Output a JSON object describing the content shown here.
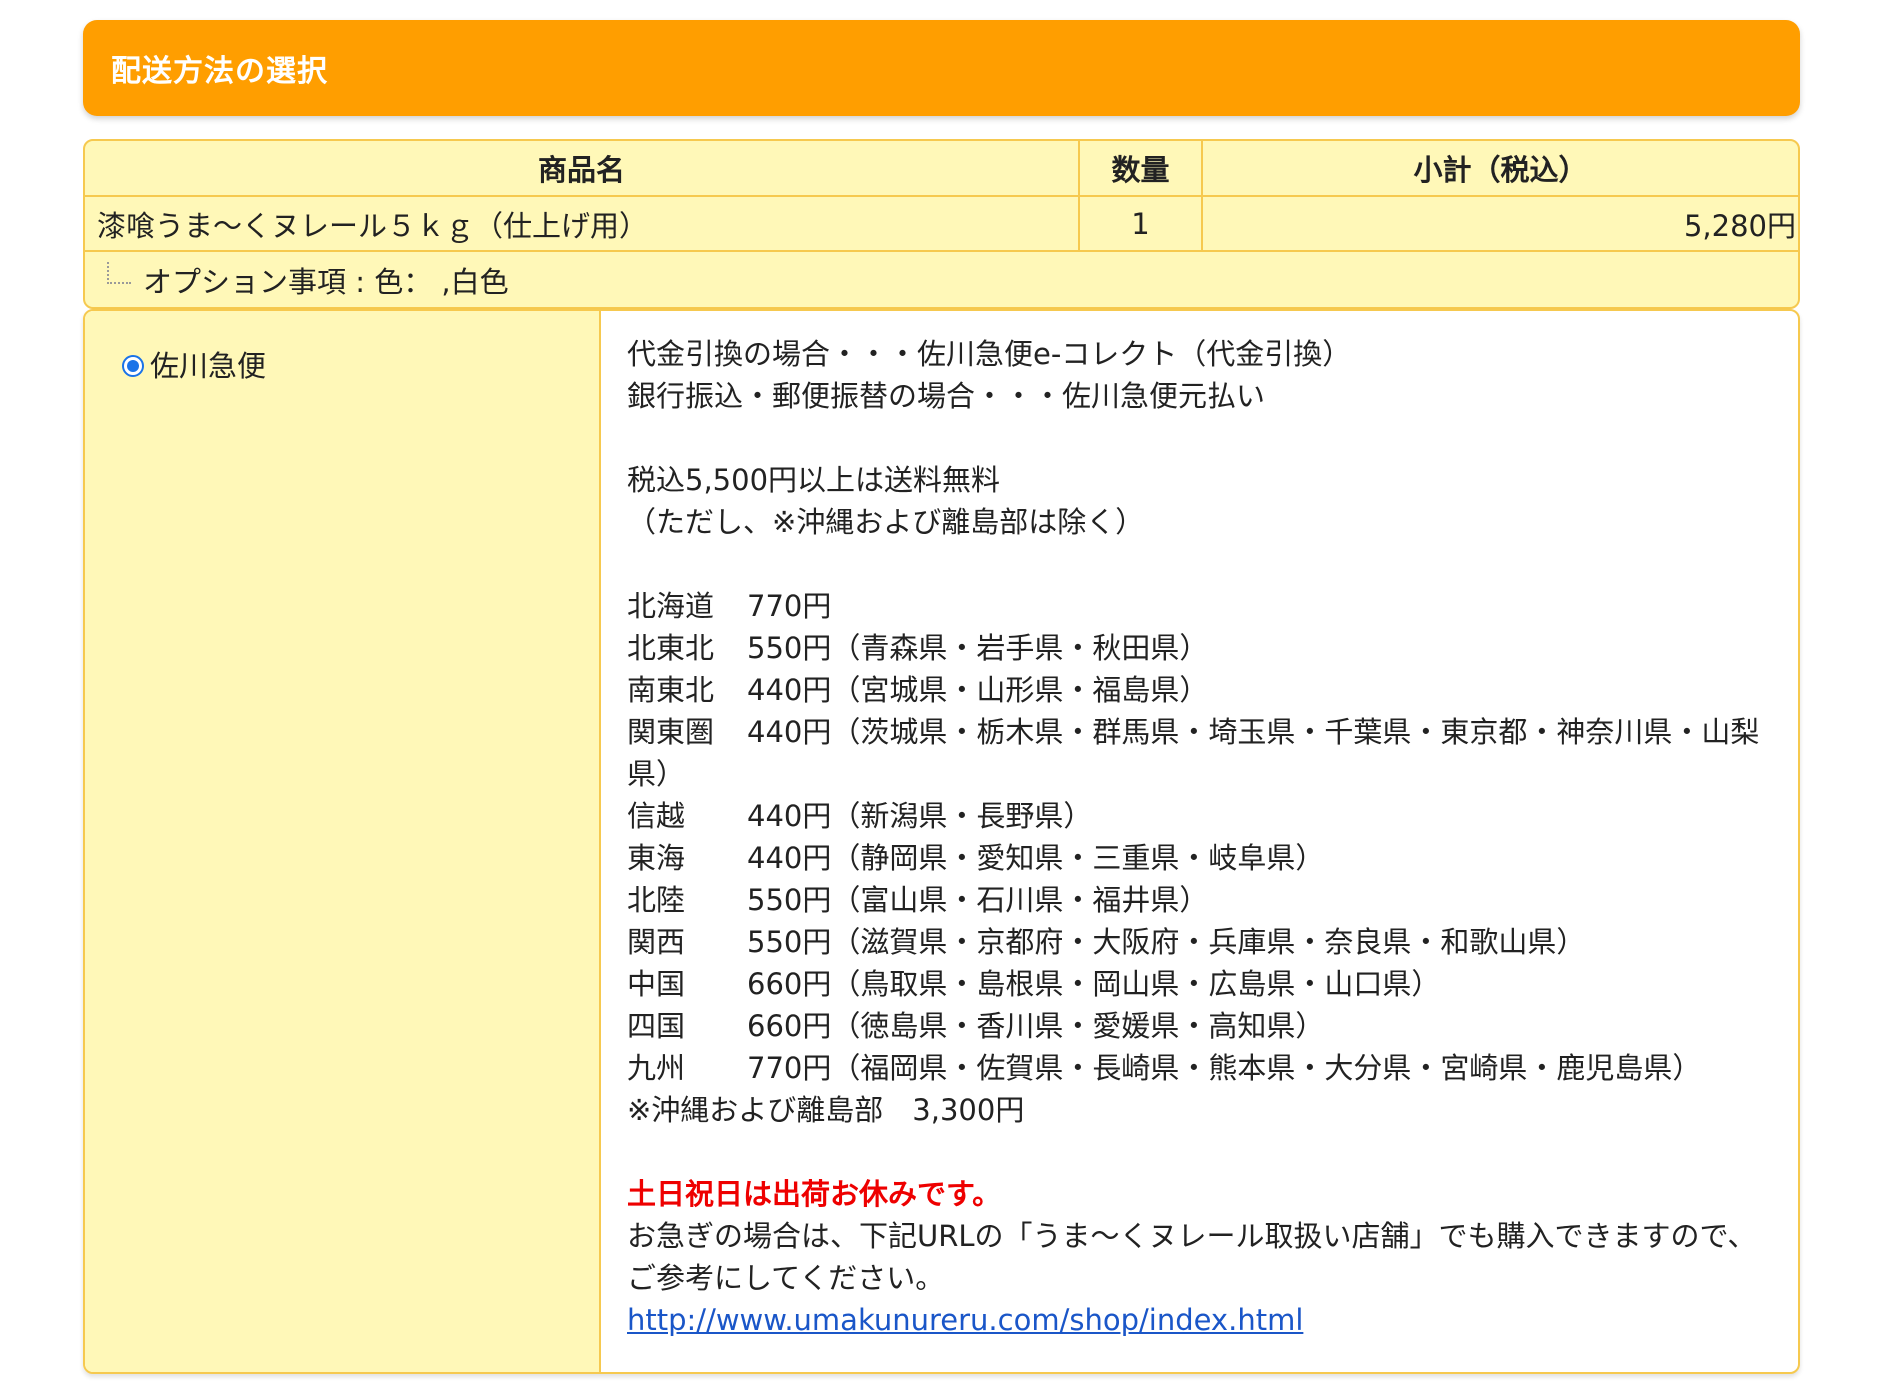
{
  "section": {
    "title": "配送方法の選択"
  },
  "table": {
    "headers": {
      "name": "商品名",
      "qty": "数量",
      "subtotal": "小計（税込）"
    },
    "item": {
      "name": "漆喰うま〜くヌレール５ｋｇ（仕上げ用）",
      "qty": "1",
      "subtotal": "5,280円"
    },
    "option": "オプション事項 : 色： ,白色"
  },
  "shipping": {
    "method_label": "佐川急便",
    "selected": true,
    "lines_a": [
      "代金引換の場合・・・佐川急便e-コレクト（代金引換）",
      "銀行振込・郵便振替の場合・・・佐川急便元払い"
    ],
    "lines_b": [
      "税込5,500円以上は送料無料",
      "（ただし、※沖縄および離島部は除く）"
    ],
    "rates": [
      {
        "region": "北海道",
        "price": "770円"
      },
      {
        "region": "北東北",
        "price": "550円（青森県・岩手県・秋田県）"
      },
      {
        "region": "南東北",
        "price": "440円（宮城県・山形県・福島県）"
      },
      {
        "region": "関東圏",
        "price": "440円（茨城県・栃木県・群馬県・埼玉県・千葉県・東京都・神奈川県・山梨県）"
      },
      {
        "region": "信越",
        "price": "440円（新潟県・長野県）"
      },
      {
        "region": "東海",
        "price": "440円（静岡県・愛知県・三重県・岐阜県）"
      },
      {
        "region": "北陸",
        "price": "550円（富山県・石川県・福井県）"
      },
      {
        "region": "関西",
        "price": "550円（滋賀県・京都府・大阪府・兵庫県・奈良県・和歌山県）"
      },
      {
        "region": "中国",
        "price": "660円（鳥取県・島根県・岡山県・広島県・山口県）"
      },
      {
        "region": "四国",
        "price": "660円（徳島県・香川県・愛媛県・高知県）"
      },
      {
        "region": "九州",
        "price": "770円（福岡県・佐賀県・長崎県・熊本県・大分県・宮崎県・鹿児島県）"
      }
    ],
    "okinawa": "※沖縄および離島部　3,300円",
    "holiday_notice": "土日祝日は出荷お休みです。",
    "hurry_notice": "お急ぎの場合は、下記URLの「うま〜くヌレール取扱い店舗」でも購入できますので、ご参考にしてください。",
    "shop_url": "http://www.umakunureru.com/shop/index.html"
  },
  "colors": {
    "header_orange": "#ff9e00",
    "table_yellow": "#fff8b8",
    "border_yellow": "#f6c94f",
    "notice_red": "#ee0000",
    "link_blue": "#1a56c8",
    "radio_blue": "#1a73e8"
  },
  "icons": {
    "tree_connector": "tree-line-icon",
    "radio": "radio-selected-icon"
  }
}
